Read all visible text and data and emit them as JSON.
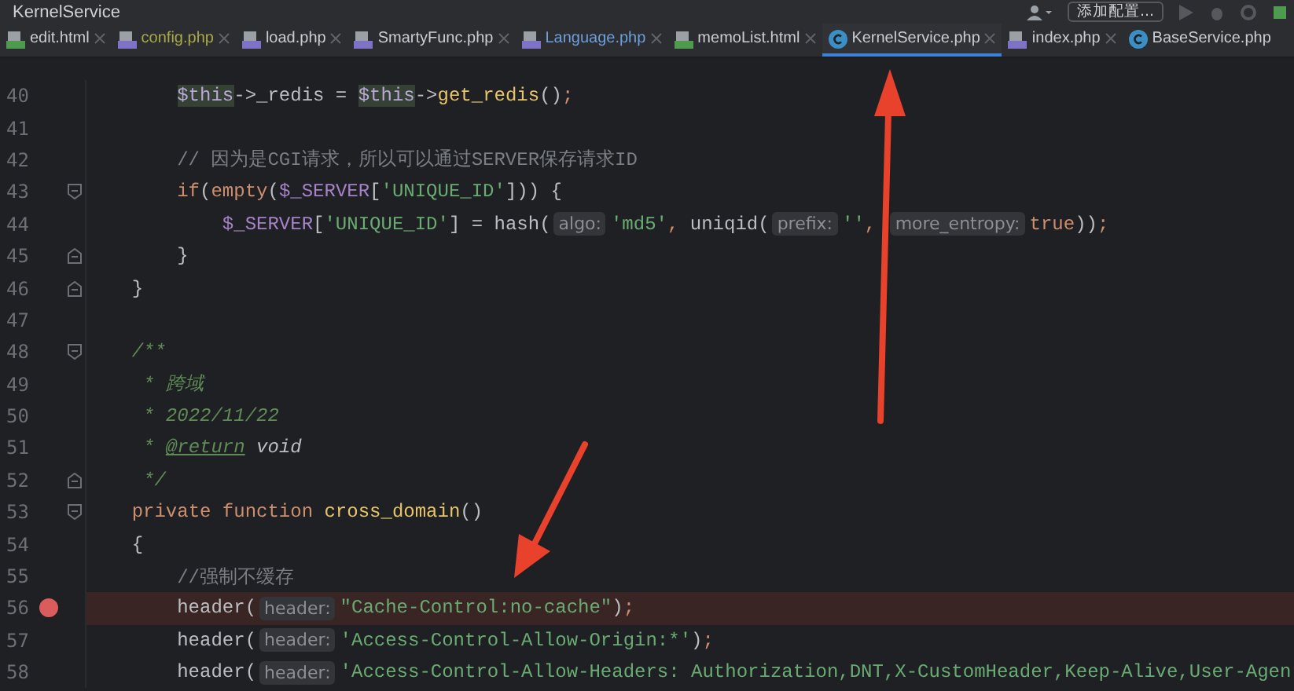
{
  "window": {
    "title": "KernelService"
  },
  "toolbar": {
    "config_button": "添加配置..."
  },
  "tabs": [
    {
      "label": "edit.html",
      "kind": "html",
      "color": "#c9ccd1",
      "selected": false,
      "closable": true
    },
    {
      "label": "config.php",
      "kind": "php",
      "color": "#a9a94a",
      "selected": false,
      "closable": true
    },
    {
      "label": "load.php",
      "kind": "php",
      "color": "#c9ccd1",
      "selected": false,
      "closable": true
    },
    {
      "label": "SmartyFunc.php",
      "kind": "php",
      "color": "#c9ccd1",
      "selected": false,
      "closable": true
    },
    {
      "label": "Language.php",
      "kind": "php",
      "color": "#6f9fd8",
      "selected": false,
      "closable": true
    },
    {
      "label": "memoList.html",
      "kind": "html",
      "color": "#c9ccd1",
      "selected": false,
      "closable": true
    },
    {
      "label": "KernelService.php",
      "kind": "class",
      "color": "#c9ccd1",
      "selected": true,
      "closable": true
    },
    {
      "label": "index.php",
      "kind": "php",
      "color": "#c9ccd1",
      "selected": false,
      "closable": true
    },
    {
      "label": "BaseService.php",
      "kind": "class",
      "color": "#c9ccd1",
      "selected": false,
      "closable": false
    }
  ],
  "editor": {
    "lines": [
      {
        "number": "40",
        "breakpoint": false,
        "fold_start": false,
        "fold_end": false,
        "tokens": [
          {
            "kind": "usage",
            "text": "        $this"
          },
          {
            "kind": "plain",
            "text": "->_redis = "
          },
          {
            "kind": "usage",
            "text": "$this"
          },
          {
            "kind": "plain",
            "text": "->"
          },
          {
            "kind": "func",
            "text": "get_redis"
          },
          {
            "kind": "plain",
            "text": "()"
          },
          {
            "kind": "keyword",
            "text": ";"
          }
        ]
      },
      {
        "number": "41",
        "breakpoint": false,
        "fold_start": false,
        "fold_end": false
      },
      {
        "number": "42",
        "breakpoint": false,
        "fold_start": false,
        "fold_end": false,
        "tokens": [
          {
            "kind": "comment",
            "text": "        // 因为是CGI请求，所以可以通过SERVER保存请求ID"
          }
        ]
      },
      {
        "number": "43",
        "breakpoint": false,
        "fold_start": true,
        "fold_end": false,
        "tokens": [
          {
            "kind": "keyword",
            "text": "        if"
          },
          {
            "kind": "plain",
            "text": "("
          },
          {
            "kind": "keyword",
            "text": "empty"
          },
          {
            "kind": "plain",
            "text": "("
          },
          {
            "kind": "var",
            "text": "$_SERVER"
          },
          {
            "kind": "plain",
            "text": "["
          },
          {
            "kind": "string",
            "text": "'UNIQUE_ID'"
          },
          {
            "kind": "plain",
            "text": "])) {"
          }
        ]
      },
      {
        "number": "44",
        "breakpoint": false,
        "fold_start": false,
        "fold_end": false,
        "tokens": [
          {
            "kind": "var",
            "text": "            $_SERVER"
          },
          {
            "kind": "plain",
            "text": "["
          },
          {
            "kind": "string",
            "text": "'UNIQUE_ID'"
          },
          {
            "kind": "plain",
            "text": "] = hash("
          },
          {
            "kind": "hint",
            "text": "algo:"
          },
          {
            "kind": "string",
            "text": "'md5'"
          },
          {
            "kind": "keyword",
            "text": ","
          },
          {
            "kind": "plain",
            "text": " uniqid("
          },
          {
            "kind": "hint",
            "text": "prefix:"
          },
          {
            "kind": "string",
            "text": "''"
          },
          {
            "kind": "keyword",
            "text": ", "
          },
          {
            "kind": "hint",
            "text": "more_entropy:"
          },
          {
            "kind": "keyword",
            "text": "true"
          },
          {
            "kind": "plain",
            "text": "))"
          },
          {
            "kind": "keyword",
            "text": ";"
          }
        ]
      },
      {
        "number": "45",
        "breakpoint": false,
        "fold_start": false,
        "fold_end": true,
        "tokens": [
          {
            "kind": "plain",
            "text": "        }"
          }
        ]
      },
      {
        "number": "46",
        "breakpoint": false,
        "fold_start": false,
        "fold_end": true,
        "tokens": [
          {
            "kind": "plain",
            "text": "    }"
          }
        ]
      },
      {
        "number": "47",
        "breakpoint": false,
        "fold_start": false,
        "fold_end": false
      },
      {
        "number": "48",
        "breakpoint": false,
        "fold_start": true,
        "fold_end": false,
        "tokens": [
          {
            "kind": "doc",
            "text": "    /**"
          }
        ]
      },
      {
        "number": "49",
        "breakpoint": false,
        "fold_start": false,
        "fold_end": false,
        "tokens": [
          {
            "kind": "doc",
            "text": "     * 跨域"
          }
        ]
      },
      {
        "number": "50",
        "breakpoint": false,
        "fold_start": false,
        "fold_end": false,
        "tokens": [
          {
            "kind": "doc",
            "text": "     * 2022/11/22"
          }
        ]
      },
      {
        "number": "51",
        "breakpoint": false,
        "fold_start": false,
        "fold_end": false,
        "tokens": [
          {
            "kind": "doc",
            "text": "     * "
          },
          {
            "kind": "doctag",
            "text": "@return"
          },
          {
            "kind": "docitalic",
            "text": " void"
          }
        ]
      },
      {
        "number": "52",
        "breakpoint": false,
        "fold_start": false,
        "fold_end": true,
        "tokens": [
          {
            "kind": "doc",
            "text": "     */"
          }
        ]
      },
      {
        "number": "53",
        "breakpoint": false,
        "fold_start": true,
        "fold_end": false,
        "tokens": [
          {
            "kind": "keyword",
            "text": "    private function "
          },
          {
            "kind": "func",
            "text": "cross_domain"
          },
          {
            "kind": "plain",
            "text": "()"
          }
        ]
      },
      {
        "number": "54",
        "breakpoint": false,
        "fold_start": false,
        "fold_end": false,
        "tokens": [
          {
            "kind": "plain",
            "text": "    {"
          }
        ]
      },
      {
        "number": "55",
        "breakpoint": false,
        "fold_start": false,
        "fold_end": false,
        "tokens": [
          {
            "kind": "comment",
            "text": "        //强制不缓存"
          }
        ]
      },
      {
        "number": "56",
        "breakpoint": true,
        "fold_start": false,
        "fold_end": false,
        "tokens": [
          {
            "kind": "plain",
            "text": "        header("
          },
          {
            "kind": "hint",
            "text": "header:"
          },
          {
            "kind": "string",
            "text": "\"Cache-Control:no-cache\""
          },
          {
            "kind": "plain",
            "text": ")"
          },
          {
            "kind": "keyword",
            "text": ";"
          }
        ]
      },
      {
        "number": "57",
        "breakpoint": false,
        "fold_start": false,
        "fold_end": false,
        "tokens": [
          {
            "kind": "plain",
            "text": "        header("
          },
          {
            "kind": "hint",
            "text": "header:"
          },
          {
            "kind": "string",
            "text": "'Access-Control-Allow-Origin:*'"
          },
          {
            "kind": "plain",
            "text": ")"
          },
          {
            "kind": "keyword",
            "text": ";"
          }
        ]
      },
      {
        "number": "58",
        "breakpoint": false,
        "fold_start": false,
        "fold_end": false,
        "tokens": [
          {
            "kind": "plain",
            "text": "        header("
          },
          {
            "kind": "hint",
            "text": "header:"
          },
          {
            "kind": "string",
            "text": "'Access-Control-Allow-Headers: Authorization,DNT,X-CustomHeader,Keep-Alive,User-Agen"
          }
        ]
      }
    ]
  }
}
